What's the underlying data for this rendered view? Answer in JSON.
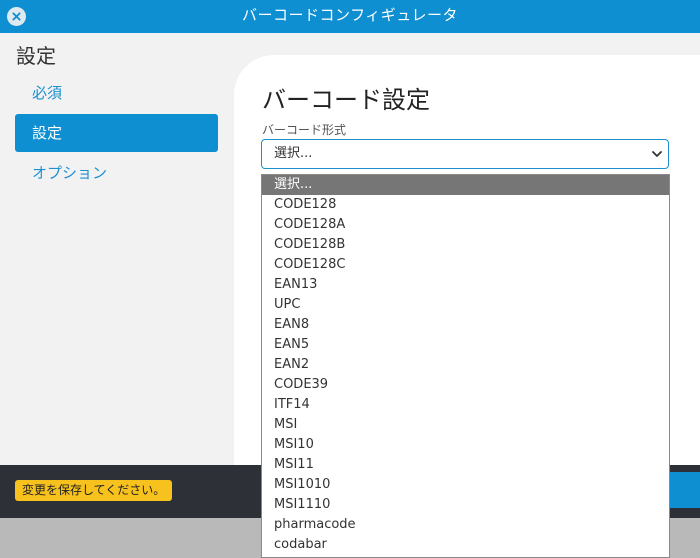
{
  "window": {
    "title": "バーコードコンフィギュレータ"
  },
  "sidebar": {
    "title": "設定",
    "items": [
      {
        "label": "必須"
      },
      {
        "label": "設定",
        "active": true
      },
      {
        "label": "オプション"
      }
    ]
  },
  "main": {
    "title": "バーコード設定",
    "format_label": "バーコード形式",
    "format_value": "選択..."
  },
  "dropdown": {
    "options": [
      "選択...",
      "CODE128",
      "CODE128A",
      "CODE128B",
      "CODE128C",
      "EAN13",
      "UPC",
      "EAN8",
      "EAN5",
      "EAN2",
      "CODE39",
      "ITF14",
      "MSI",
      "MSI10",
      "MSI11",
      "MSI1010",
      "MSI1110",
      "pharmacode",
      "codabar"
    ],
    "selected_index": 0
  },
  "footer": {
    "save_notice": "変更を保存してください。"
  },
  "colors": {
    "accent": "#0e8fd1",
    "warning": "#f7c21e",
    "footer": "#2d3137"
  }
}
